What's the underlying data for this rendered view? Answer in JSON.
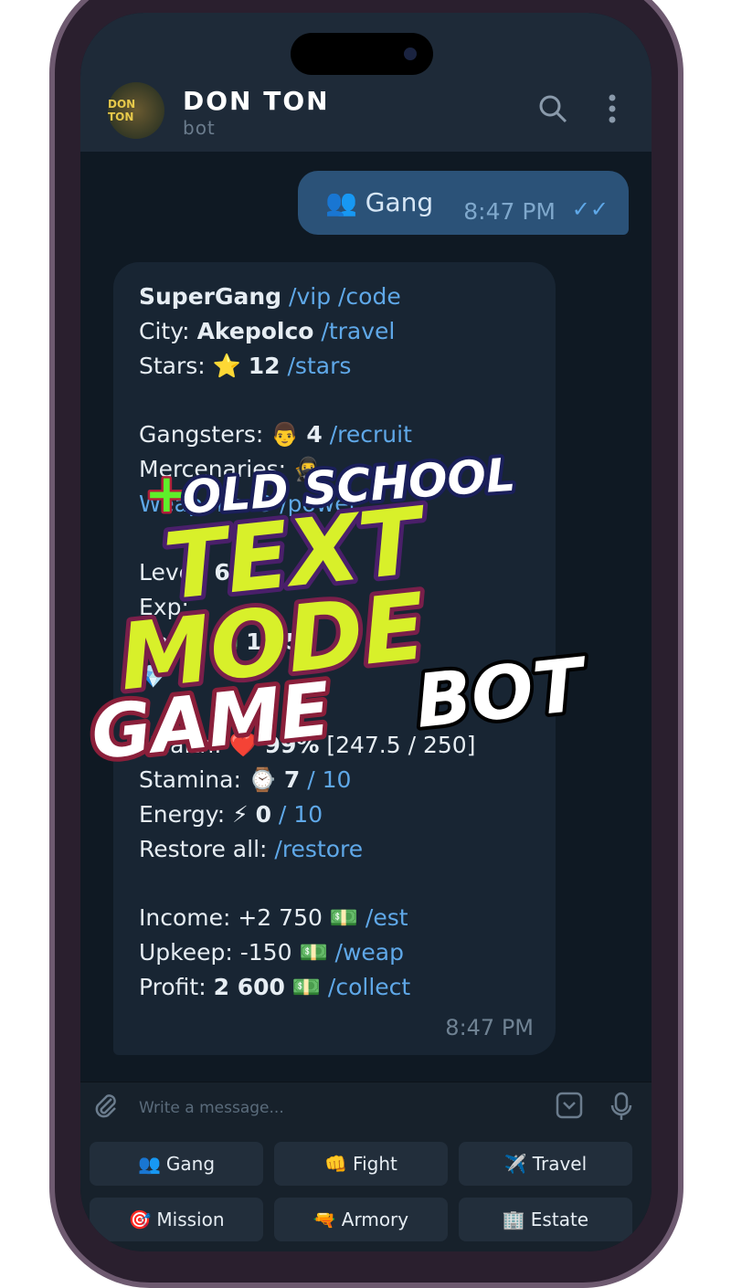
{
  "header": {
    "title": "DON TON",
    "subtitle": "bot",
    "avatar_text": "DON TON",
    "search_icon": "search-icon",
    "menu_icon": "more-vertical-icon"
  },
  "outgoing": {
    "emoji": "👥",
    "text": "Gang",
    "time": "8:47 PM",
    "status": "read"
  },
  "incoming": {
    "lines": [
      [
        "SuperGang",
        " /vip /code"
      ],
      [
        "City: ",
        "Akepolco",
        " /travel"
      ],
      [
        "Stars: ⭐ ",
        "12",
        " /stars"
      ],
      [],
      [
        "Gangsters: 👨 ",
        "4",
        " /recruit"
      ],
      [
        "Mercenaries: 🥷"
      ],
      [
        "Weapons: 3 /power"
      ],
      [],
      [
        "Level: ",
        "6"
      ],
      [
        "Exp:"
      ],
      [
        "Cash: 💵 ",
        "13 5"
      ],
      [
        "💎"
      ],
      [],
      [
        "Health: ❤️ ",
        "99%",
        " [247.5 / 250]"
      ],
      [
        "Stamina: ⌚ ",
        "7",
        " / 10"
      ],
      [
        "Energy: ⚡ ",
        "0",
        " / 10"
      ],
      [
        "Restore all: ",
        "/restore"
      ],
      [],
      [
        "Income: +2 750 💵 ",
        "/est"
      ],
      [
        "Upkeep: -150 💵 ",
        "/weap"
      ],
      [
        "Profit: ",
        "2 600",
        " 💵 /collect"
      ]
    ],
    "time": "8:47 PM"
  },
  "overlay": {
    "line1": "OLD SCHOOL",
    "line2": "TEXT",
    "line3": "MODE",
    "line4": "GAME",
    "line5": "BOT",
    "plus": "+"
  },
  "input": {
    "placeholder": "Write a message..."
  },
  "keyboard": [
    {
      "emoji": "👥",
      "label": "Gang"
    },
    {
      "emoji": "👊",
      "label": "Fight"
    },
    {
      "emoji": "✈️",
      "label": "Travel"
    },
    {
      "emoji": "🎯",
      "label": "Mission"
    },
    {
      "emoji": "🔫",
      "label": "Armory"
    },
    {
      "emoji": "🏢",
      "label": "Estate"
    }
  ],
  "colors": {
    "accent": "#5fa8e8",
    "bubble_out": "#2b5278",
    "bubble_in": "#182533",
    "overlay_yellow": "#d8f02a"
  }
}
